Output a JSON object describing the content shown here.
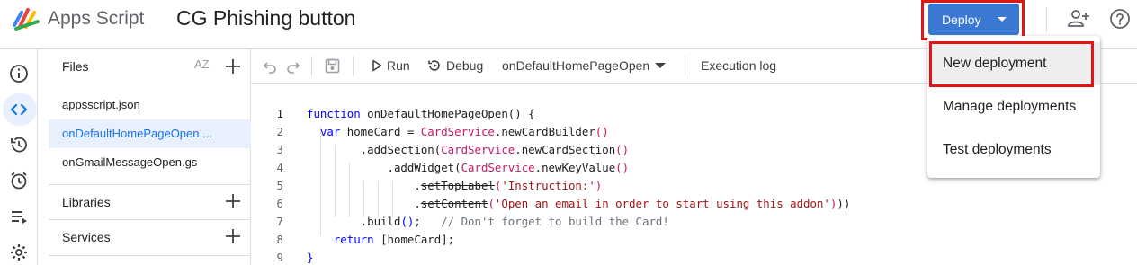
{
  "header": {
    "app_name": "Apps Script",
    "project_title": "CG Phishing button",
    "deploy_label": "Deploy",
    "add_person_icon": "person-add-icon",
    "help_icon": "help-icon"
  },
  "rail": {
    "icons": [
      "info-icon",
      "code-icon",
      "history-icon",
      "alarm-icon",
      "executions-icon",
      "settings-icon"
    ],
    "active": "code-icon"
  },
  "files": {
    "title": "Files",
    "sort_label": "AZ",
    "items": [
      {
        "name": "appsscript.json",
        "active": false
      },
      {
        "name": "onDefaultHomePageOpen....",
        "active": true
      },
      {
        "name": "onGmailMessageOpen.gs",
        "active": false
      }
    ],
    "libraries_label": "Libraries",
    "services_label": "Services"
  },
  "toolbar": {
    "run_label": "Run",
    "debug_label": "Debug",
    "function_select": "onDefaultHomePageOpen",
    "execution_log_label": "Execution log"
  },
  "editor": {
    "current_line": 1,
    "lines": [
      {
        "n": "1",
        "html": [
          [
            "kw",
            "function "
          ],
          [
            "fn",
            "onDefaultHomePageOpen"
          ],
          [
            "",
            "() {"
          ]
        ]
      },
      {
        "n": "2",
        "html": [
          [
            "",
            "  "
          ],
          [
            "kw",
            "var "
          ],
          [
            "",
            "homeCard = "
          ],
          [
            "cls",
            "CardService"
          ],
          [
            "",
            ".newCardBuilder"
          ],
          [
            "cls",
            "()"
          ]
        ]
      },
      {
        "n": "3",
        "html": [
          [
            "",
            "        .addSection("
          ],
          [
            "cls",
            "CardService"
          ],
          [
            "",
            ".newCardSection"
          ],
          [
            "cls",
            "()"
          ]
        ]
      },
      {
        "n": "4",
        "html": [
          [
            "",
            "            .addWidget("
          ],
          [
            "cls",
            "CardService"
          ],
          [
            "",
            ".newKeyValue"
          ],
          [
            "cls",
            "()"
          ]
        ]
      },
      {
        "n": "5",
        "html": [
          [
            "",
            "                ."
          ],
          [
            "strike",
            "setTopLabel"
          ],
          [
            "cls",
            "("
          ],
          [
            "str",
            "'Instruction:'"
          ],
          [
            "cls",
            ")"
          ]
        ]
      },
      {
        "n": "6",
        "html": [
          [
            "",
            "                ."
          ],
          [
            "strike",
            "setContent"
          ],
          [
            "cls",
            "("
          ],
          [
            "str",
            "'Open an email in order to start using this addon'"
          ],
          [
            "cls",
            ")"
          ],
          [
            "",
            "))"
          ]
        ]
      },
      {
        "n": "7",
        "html": [
          [
            "",
            "        .build"
          ],
          [
            "kw",
            "()"
          ],
          [
            "",
            ";   "
          ],
          [
            "cm",
            "// Don't forget to build the Card!"
          ]
        ]
      },
      {
        "n": "8",
        "html": [
          [
            "",
            "    "
          ],
          [
            "kw",
            "return "
          ],
          [
            "",
            "[homeCard];"
          ]
        ]
      },
      {
        "n": "9",
        "html": [
          [
            "kw",
            "}"
          ]
        ]
      }
    ]
  },
  "deploy_menu": {
    "items": [
      "New deployment",
      "Manage deployments",
      "Test deployments"
    ],
    "highlighted": "New deployment"
  },
  "colors": {
    "deploy_blue": "#3b78d3",
    "highlight_red": "#e01515",
    "active_file_bg": "#e8f0fe",
    "active_file_text": "#1a73e8"
  }
}
